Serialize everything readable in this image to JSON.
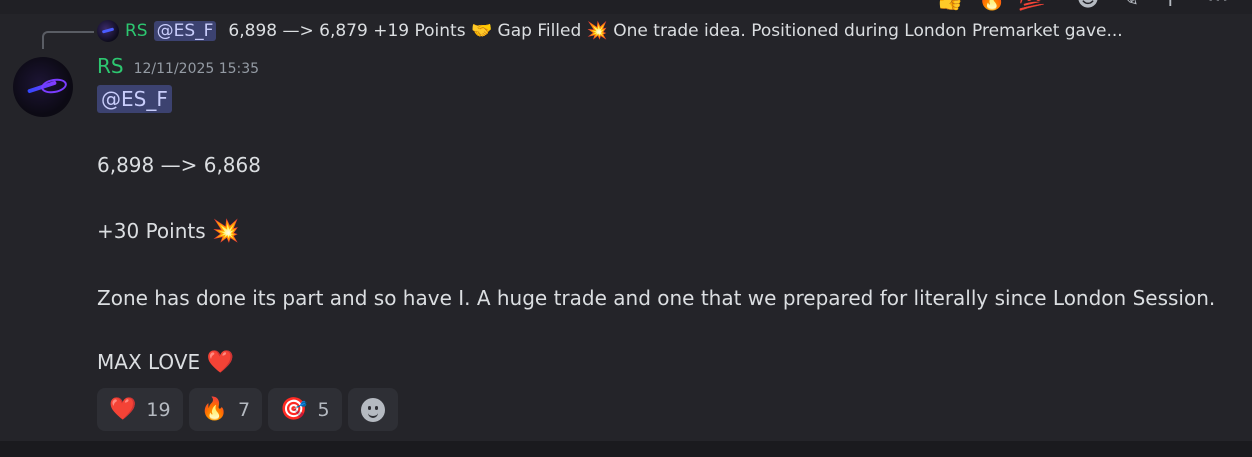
{
  "reply": {
    "author": "RS",
    "mention": "@ES_F",
    "text": "6,898 —> 6,879   +19 Points 🤝  Gap Filled 💥  One trade idea.  Positioned during London  Premarket gave..."
  },
  "action_bar": {
    "icons": [
      "thumbs-up-icon",
      "fire-icon",
      "hundred-icon",
      "add-reaction-icon",
      "edit-icon",
      "reply-icon",
      "more-icon"
    ]
  },
  "message": {
    "author": "RS",
    "timestamp": "12/11/2025 15:35",
    "mention": "@ES_F",
    "lines": [
      "6,898 —> 6,868",
      "+30 Points",
      "Zone has done its part and so have I. A huge trade and one that we prepared for literally since London Session.",
      "MAX LOVE"
    ],
    "emojis": {
      "points": "💥",
      "love": "❤️"
    }
  },
  "reactions": [
    {
      "emoji": "❤️",
      "icon": "heart-icon",
      "count": "19"
    },
    {
      "emoji": "🔥",
      "icon": "fire-icon",
      "count": "7"
    },
    {
      "emoji": "🎯",
      "icon": "target-icon",
      "count": "5"
    }
  ],
  "colors": {
    "author": "#2dc770",
    "mention_bg": "#3c4270",
    "background": "#242429"
  }
}
